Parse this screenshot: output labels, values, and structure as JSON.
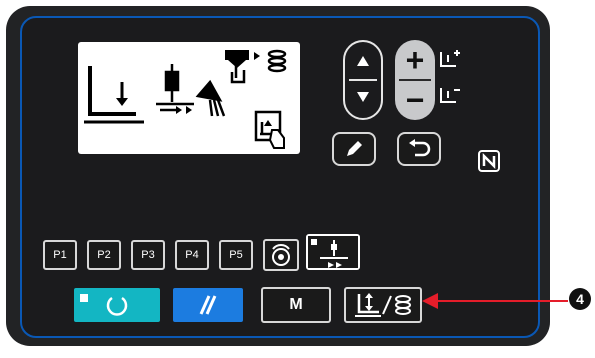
{
  "panel": {
    "colors": {
      "body": "#222325",
      "frame": "#0a58b5",
      "lcd": "#ffffff",
      "teal": "#13b6c3",
      "blue": "#1c7ce0",
      "pointer": "#e51d2a"
    }
  },
  "lcd": {
    "icons": [
      "tension-down-icon",
      "bobbin-winder-icon",
      "presser-foot-lift-icon",
      "needle-thread-trimmer-icon",
      "bobbin-hand-touch-icon"
    ]
  },
  "keys": {
    "p_buttons": [
      {
        "label": "P1"
      },
      {
        "label": "P2"
      },
      {
        "label": "P3"
      },
      {
        "label": "P4"
      },
      {
        "label": "P5"
      }
    ],
    "plus_label": "+",
    "minus_label": "−",
    "mode_label": "M"
  },
  "callout": {
    "number": "4"
  }
}
